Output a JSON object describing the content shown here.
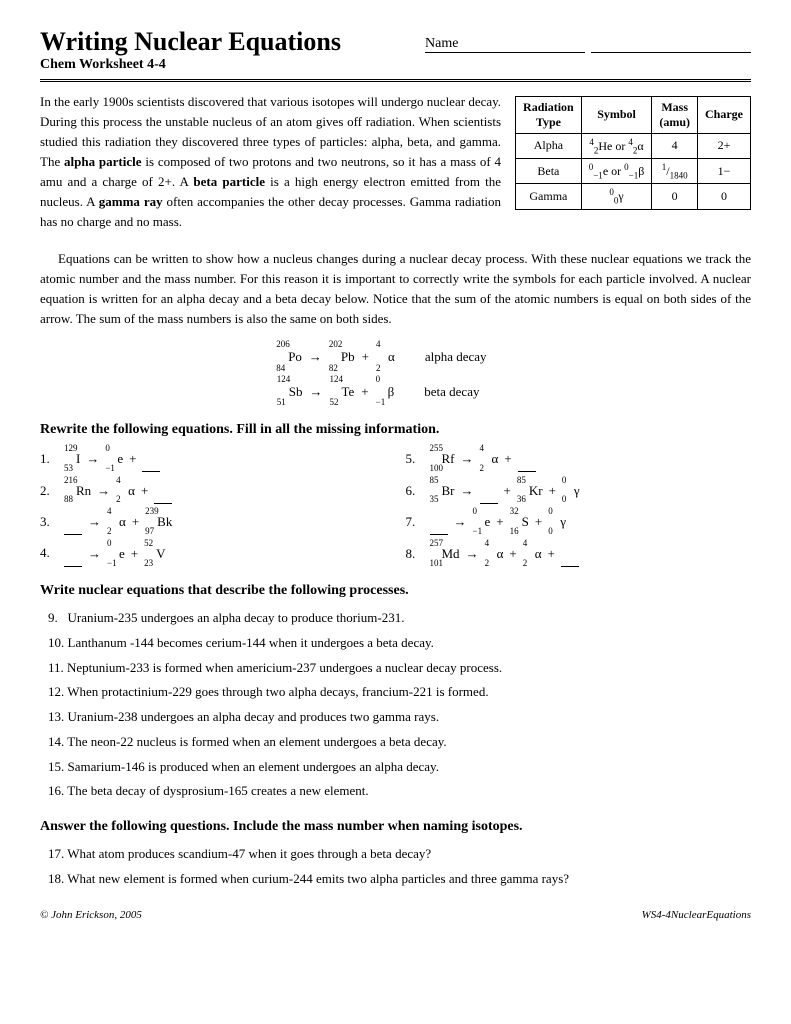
{
  "header": {
    "title": "Writing Nuclear Equations",
    "subtitle": "Chem Worksheet 4-4",
    "name_label": "Name"
  },
  "intro": {
    "paragraphs": [
      "In the early 1900s scientists discovered that various isotopes will undergo nuclear decay. During this process the unstable nucleus of an atom gives off radiation. When scientists studied this radiation they discovered three types of particles: alpha, beta, and gamma. The alpha particle is composed of two protons and two neutrons, so it has a mass of 4 amu and a charge of 2+. A beta particle is a high energy electron emitted from the nucleus. A gamma ray often accompanies the other decay processes. Gamma radiation has no charge and no mass.",
      "Equations can be written to show how a nucleus changes during a nuclear decay process. With these nuclear equations we track the atomic number and the mass number. For this reason it is important to correctly write the symbols for each particle involved. A nuclear equation is written for an alpha decay and a beta decay below. Notice that the sum of the atomic numbers is equal on both sides of the arrow. The sum of the mass numbers is also the same on both sides."
    ]
  },
  "radiation_table": {
    "headers": [
      "Radiation Type",
      "Symbol",
      "Mass (amu)",
      "Charge"
    ],
    "rows": [
      [
        "Alpha",
        "⁴₂He or ⁴₂α",
        "4",
        "2+"
      ],
      [
        "Beta",
        "⁰₋₁e or ⁰₋₁β",
        "1/1840",
        "1−"
      ],
      [
        "Gamma",
        "⁰₀γ",
        "0",
        "0"
      ]
    ]
  },
  "example_equations": [
    {
      "formula": "²⁰⁶₈₄Po → ²⁰²₈₂Pb + ⁴₂α",
      "label": "alpha decay"
    },
    {
      "formula": "¹²⁴₅₁Sb → ¹²⁴₅₂Te + ⁰₋₁β",
      "label": "beta decay"
    }
  ],
  "section1": {
    "header": "Rewrite the following equations. Fill in all the missing information.",
    "problems": [
      {
        "num": "1.",
        "eq": "¹²⁹₅₃I → ⁰₋₁e + ?"
      },
      {
        "num": "5.",
        "eq": "²⁵⁵₁₀₀Rf → ⁴₂α + ?"
      },
      {
        "num": "2.",
        "eq": "²¹⁶₈₈Rn → ⁴₂α + ?"
      },
      {
        "num": "6.",
        "eq": "⁸⁵₃₅Br → ? + ⁸⁵₃₆Kr + ⁰₀γ"
      },
      {
        "num": "3.",
        "eq": "? → ⁴₂α + ²³⁹₉₇Bk"
      },
      {
        "num": "7.",
        "eq": "? → ⁰₋₁e + ³²₁₆S + ⁰₀γ"
      },
      {
        "num": "4.",
        "eq": "? → ⁰₋₁e + ⁵²₂₃V"
      },
      {
        "num": "8.",
        "eq": "²⁵⁷₁₀₁Md → ⁴₂α + ⁴₂α + ?"
      }
    ]
  },
  "section2": {
    "header": "Write nuclear equations that describe the following processes.",
    "problems": [
      "9.   Uranium-235 undergoes an alpha decay to produce thorium-231.",
      "10. Lanthanum -144 becomes cerium-144 when it undergoes a beta decay.",
      "11. Neptunium-233 is formed when americium-237 undergoes a nuclear decay process.",
      "12. When protactinium-229 goes through two alpha decays, francium-221 is formed.",
      "13. Uranium-238 undergoes an alpha decay and produces two gamma rays.",
      "14. The neon-22 nucleus is formed when an element undergoes a beta decay.",
      "15. Samarium-146 is produced when an element undergoes an alpha decay.",
      "16. The beta decay of dysprosium-165 creates a new element."
    ]
  },
  "section3": {
    "header": "Answer the following questions. Include the mass number when naming isotopes.",
    "problems": [
      "17. What atom produces scandium-47 when it goes through a beta decay?",
      "18. What new element is formed when curium-244 emits two alpha particles and three gamma rays?"
    ]
  },
  "footer": {
    "copyright": "© John Erickson, 2005",
    "code": "WS4-4NuclearEquations"
  }
}
